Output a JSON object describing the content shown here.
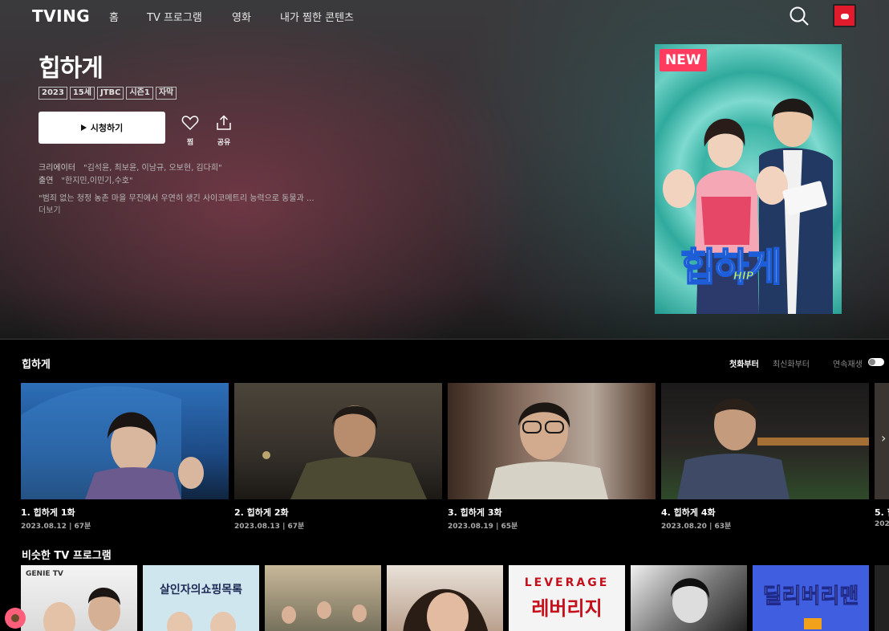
{
  "nav": {
    "logo": "TVING",
    "links": [
      "홈",
      "TV 프로그램",
      "영화",
      "내가 찜한 콘텐츠"
    ]
  },
  "hero": {
    "title": "힙하게",
    "badges": [
      "2023",
      "15세",
      "JTBC",
      "시즌1",
      "자막"
    ],
    "play_label": "시청하기",
    "like_label": "찜",
    "share_label": "공유",
    "creator_key": "크리에이터",
    "creator_value": "\"김석윤, 최보윤, 이남규, 오보현, 김다희\"",
    "cast_key": "출연",
    "cast_value": "\"한지민,이민기,수호\"",
    "synopsis": "\"범죄 없는 청정 농촌 마을 무진에서 우연히 생긴 사이코메트리 능력으로 동물과 ...",
    "more_label": "더보기"
  },
  "poster": {
    "badge": "NEW",
    "title": "힙하게",
    "subtitle": "HIP"
  },
  "episodes_section": {
    "title": "힙하게",
    "sort_first": "첫화부터",
    "sort_latest": "최신화부터",
    "autoplay_label": "연속재생",
    "items": [
      {
        "title": "1. 힙하게 1화",
        "meta": "2023.08.12 | 67분"
      },
      {
        "title": "2. 힙하게 2화",
        "meta": "2023.08.13 | 67분"
      },
      {
        "title": "3. 힙하게 3화",
        "meta": "2023.08.19 | 65분"
      },
      {
        "title": "4. 힙하게 4화",
        "meta": "2023.08.20 | 63분"
      },
      {
        "title": "5. 힙",
        "meta": "202"
      }
    ]
  },
  "similar_section": {
    "title": "비슷한 TV 프로그램",
    "items": [
      {
        "text": "GENIE TV"
      },
      {
        "text": "살인자의쇼핑목록"
      },
      {
        "text": ""
      },
      {
        "text": ""
      },
      {
        "text": "LEVERAGE",
        "text2": "레버리지"
      },
      {
        "text": ""
      },
      {
        "text": "딜리버리맨"
      }
    ]
  },
  "colors": {
    "accent": "#ff3b5f",
    "profile": "#e11a2c"
  }
}
